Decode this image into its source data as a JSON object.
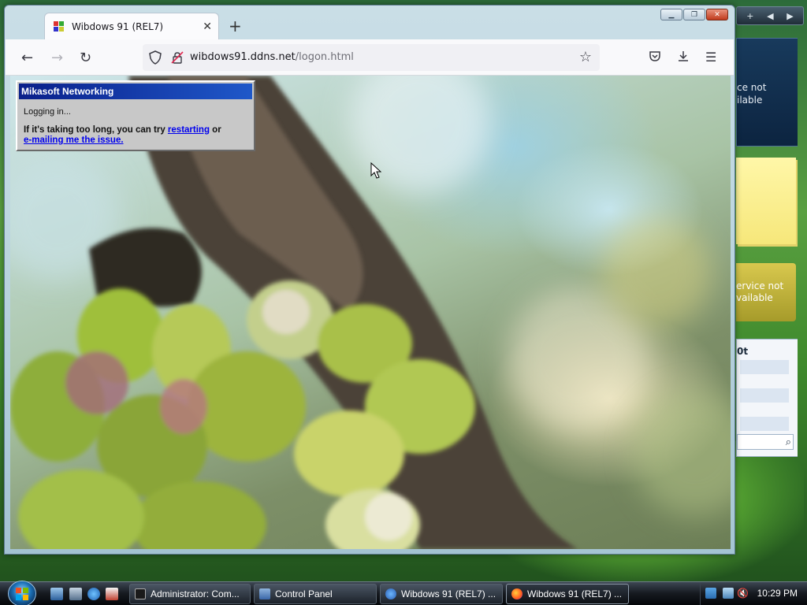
{
  "window": {
    "tab_title": "Wibdows 91 (REL7)",
    "url_host": "wibdows91.ddns.net",
    "url_path": "/logon.html"
  },
  "dialog": {
    "title": "Mikasoft Networking",
    "status": "Logging in...",
    "message_prefix": "If it's taking too long, you can try ",
    "link_restart": "restarting",
    "message_middle": " or",
    "link_email": "e-mailing me the issue."
  },
  "sidebar": {
    "news_text_1": "ce not",
    "news_text_2": "ilable",
    "weather_text_1": "ervice not",
    "weather_text_2": "vailable",
    "search_header": "0t"
  },
  "taskbar": {
    "tasks": [
      {
        "label": "Administrator: Com..."
      },
      {
        "label": "Control Panel"
      },
      {
        "label": "Wibdows 91 (REL7) ..."
      },
      {
        "label": "Wibdows 91 (REL7) ..."
      }
    ],
    "clock": "10:29 PM"
  },
  "colors": {
    "dialog_title_start": "#0a1f8a",
    "dialog_title_end": "#1f58c9",
    "link": "#0000ee"
  }
}
